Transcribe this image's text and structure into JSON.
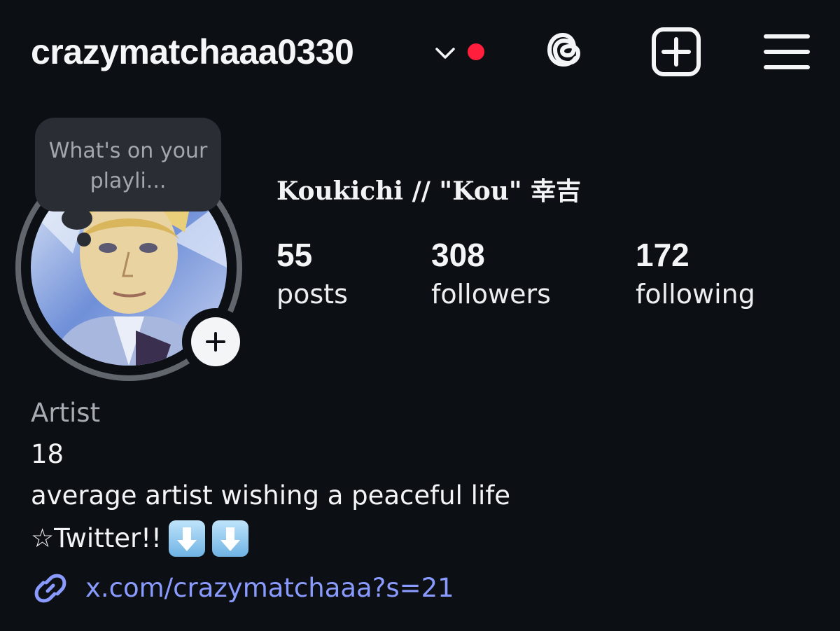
{
  "header": {
    "username": "crazymatchaaa0330",
    "icons": [
      "chevron-down-icon",
      "notification-dot",
      "threads-icon",
      "create-post-icon",
      "menu-icon"
    ]
  },
  "note": {
    "text": "What's on your playli..."
  },
  "profile": {
    "display_name": "Koukichi // \"Kou\" 幸吉",
    "stats": [
      {
        "value": "55",
        "label": "posts"
      },
      {
        "value": "308",
        "label": "followers"
      },
      {
        "value": "172",
        "label": "following"
      }
    ]
  },
  "bio": {
    "category": "Artist",
    "lines": [
      "18",
      "average artist wishing a peaceful life",
      "☆Twitter!!"
    ],
    "link": "x.com/crazymatchaaa?s=21"
  },
  "colors": {
    "background": "#0c0f14",
    "notification_dot": "#ff1f3d",
    "link": "#8a9bff",
    "muted_text": "#a8abb2"
  }
}
